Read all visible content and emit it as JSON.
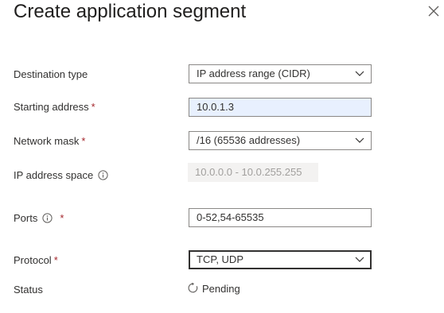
{
  "panel": {
    "title": "Create application segment",
    "close_icon": "close-icon"
  },
  "form": {
    "destination_type": {
      "label": "Destination type",
      "value": "IP address range (CIDR)"
    },
    "starting_address": {
      "label": "Starting address",
      "required": "*",
      "value": "10.0.1.3"
    },
    "network_mask": {
      "label": "Network mask",
      "required": "*",
      "value": "/16 (65536 addresses)"
    },
    "ip_address_space": {
      "label": "IP address space",
      "value": "10.0.0.0 - 10.0.255.255",
      "icon": "info-icon"
    },
    "ports": {
      "label": "Ports",
      "required": "*",
      "value": "0-52,54-65535",
      "icon": "info-icon"
    },
    "protocol": {
      "label": "Protocol",
      "required": "*",
      "value": "TCP, UDP"
    },
    "status": {
      "label": "Status",
      "value": "Pending",
      "icon": "spinner-icon"
    }
  },
  "colors": {
    "required": "#a4262c",
    "autofill_bg": "#e8f0fe",
    "readonly_bg": "#f3f2f1"
  }
}
